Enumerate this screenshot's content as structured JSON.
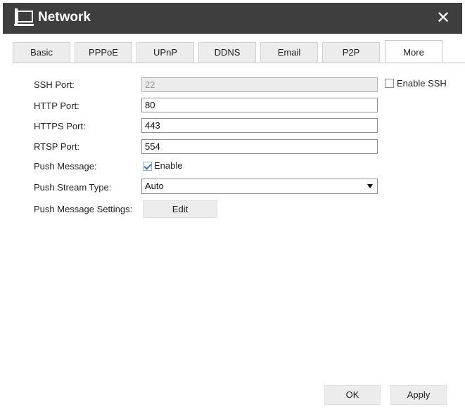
{
  "window": {
    "title": "Network",
    "icon": "network-computer-icon",
    "close_glyph": "✕"
  },
  "tabs": [
    {
      "label": "Basic",
      "active": false
    },
    {
      "label": "PPPoE",
      "active": false
    },
    {
      "label": "UPnP",
      "active": false
    },
    {
      "label": "DDNS",
      "active": false
    },
    {
      "label": "Email",
      "active": false
    },
    {
      "label": "P2P",
      "active": false
    },
    {
      "label": "More",
      "active": true
    }
  ],
  "form": {
    "ssh_port": {
      "label": "SSH Port:",
      "value": "22",
      "disabled": true
    },
    "enable_ssh": {
      "label": "Enable SSH",
      "checked": false
    },
    "http_port": {
      "label": "HTTP Port:",
      "value": "80"
    },
    "https_port": {
      "label": "HTTPS Port:",
      "value": "443"
    },
    "rtsp_port": {
      "label": "RTSP Port:",
      "value": "554"
    },
    "push_message": {
      "label": "Push Message:",
      "checkbox_label": "Enable",
      "checked": true
    },
    "push_stream_type": {
      "label": "Push Stream Type:",
      "value": "Auto"
    },
    "push_message_settings": {
      "label": "Push Message Settings:",
      "button_label": "Edit"
    }
  },
  "footer": {
    "ok_label": "OK",
    "apply_label": "Apply"
  },
  "colors": {
    "titlebar": "#3e3e3e",
    "tab_inactive": "#ececec",
    "button": "#ececec",
    "checkmark": "#2d6fc4"
  }
}
